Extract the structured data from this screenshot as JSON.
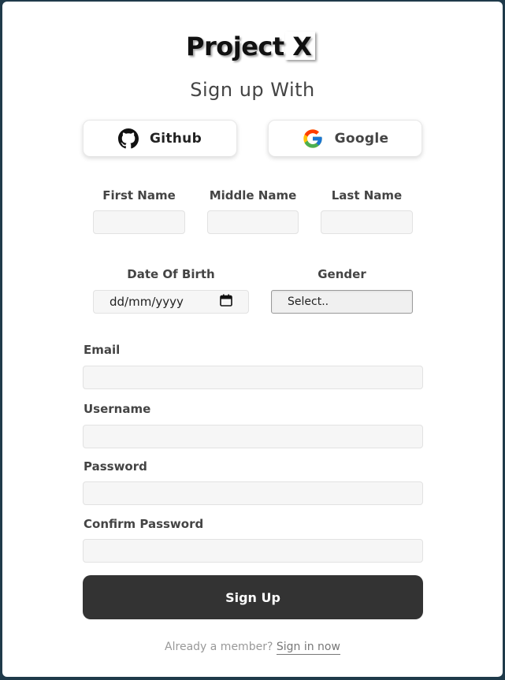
{
  "brand": {
    "logo_text": "Project X"
  },
  "heading": "Sign up With",
  "social": {
    "github_label": "Github",
    "google_label": "Google"
  },
  "name_fields": {
    "first_label": "First Name",
    "middle_label": "Middle Name",
    "last_label": "Last Name"
  },
  "dob": {
    "label": "Date Of Birth",
    "placeholder": "dd/mm/yyyy"
  },
  "gender": {
    "label": "Gender",
    "selected": "Select.."
  },
  "email": {
    "label": "Email"
  },
  "username": {
    "label": "Username"
  },
  "password": {
    "label": "Password"
  },
  "confirm_password": {
    "label": "Confirm Password"
  },
  "submit_label": "Sign Up",
  "footer": {
    "prompt": "Already a member?",
    "link": "Sign in now"
  },
  "colors": {
    "button": "#333333",
    "background": "#1f3a4a",
    "input_bg": "#f6f6f6"
  }
}
